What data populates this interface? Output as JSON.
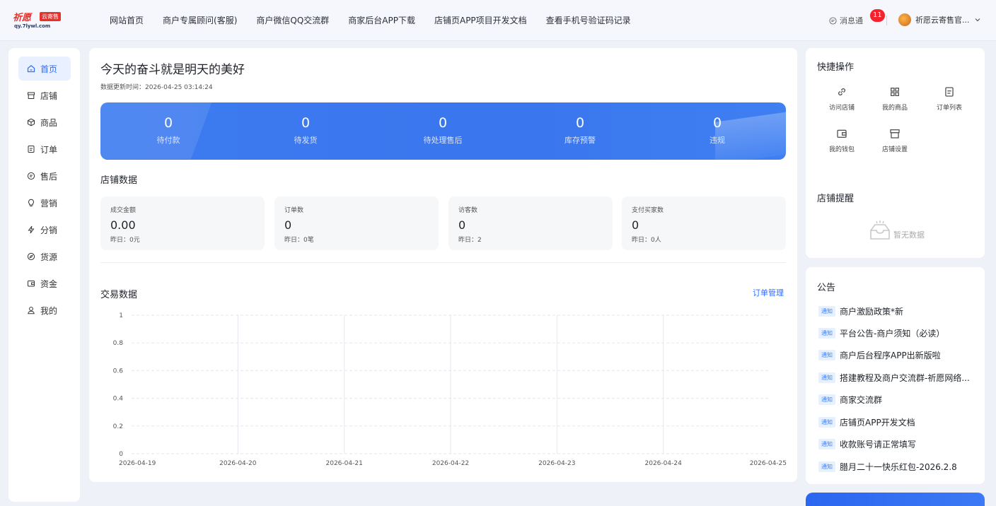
{
  "brand": {
    "logo_text": "祈愿",
    "logo_tag": "云寄售",
    "logo_url": "qy.7lywl.com"
  },
  "topnav": [
    "网站首页",
    "商户专属顾问(客服)",
    "商户微信QQ交流群",
    "商家后台APP下载",
    "店铺页APP项目开发文档",
    "查看手机号验证码记录"
  ],
  "header": {
    "messages_label": "消息通",
    "message_count": "11",
    "user_name": "祈愿云寄售官..."
  },
  "sidebar": {
    "items": [
      {
        "label": "首页",
        "icon": "home-icon",
        "active": true
      },
      {
        "label": "店铺",
        "icon": "store-icon"
      },
      {
        "label": "商品",
        "icon": "box-icon"
      },
      {
        "label": "订单",
        "icon": "order-icon"
      },
      {
        "label": "售后",
        "icon": "aftersale-icon"
      },
      {
        "label": "营销",
        "icon": "bulb-icon"
      },
      {
        "label": "分销",
        "icon": "lightning-icon"
      },
      {
        "label": "货源",
        "icon": "compass-icon"
      },
      {
        "label": "资金",
        "icon": "wallet-icon"
      },
      {
        "label": "我的",
        "icon": "user-icon"
      }
    ]
  },
  "main": {
    "title": "今天的奋斗就是明天的美好",
    "update_time": "数据更新时间：2026-04-25 03:14:24",
    "banner": [
      {
        "value": "0",
        "label": "待付款"
      },
      {
        "value": "0",
        "label": "待发货"
      },
      {
        "value": "0",
        "label": "待处理售后"
      },
      {
        "value": "0",
        "label": "库存预警"
      },
      {
        "value": "0",
        "label": "违规"
      }
    ],
    "store_data_title": "店铺数据",
    "cards": [
      {
        "label": "成交金额",
        "value": "0.00",
        "yesterday": "昨日：0元"
      },
      {
        "label": "订单数",
        "value": "0",
        "yesterday": "昨日：0笔"
      },
      {
        "label": "访客数",
        "value": "0",
        "yesterday": "昨日：2"
      },
      {
        "label": "支付买家数",
        "value": "0",
        "yesterday": "昨日：0人"
      }
    ],
    "trade_title": "交易数据",
    "order_manage": "订单管理"
  },
  "chart_data": {
    "type": "line",
    "categories": [
      "2026-04-19",
      "2026-04-20",
      "2026-04-21",
      "2026-04-22",
      "2026-04-23",
      "2026-04-24",
      "2026-04-25"
    ],
    "values": [
      0,
      0,
      0,
      0,
      0,
      0,
      0
    ],
    "yticks": [
      "0",
      "0.2",
      "0.4",
      "0.6",
      "0.8",
      "1"
    ],
    "ylim": [
      0,
      1
    ],
    "grid": true,
    "line_colors": [
      "#3bd1e8",
      "#6b5cf0"
    ]
  },
  "quick": {
    "title": "快捷操作",
    "items": [
      {
        "label": "访问店铺",
        "icon": "link-icon"
      },
      {
        "label": "我的商品",
        "icon": "grid-icon"
      },
      {
        "label": "订单列表",
        "icon": "list-icon"
      },
      {
        "label": "我的钱包",
        "icon": "wallet-icon"
      },
      {
        "label": "店铺设置",
        "icon": "store-settings-icon"
      }
    ]
  },
  "reminder": {
    "title": "店铺提醒",
    "empty": "暂无数据"
  },
  "notices": {
    "title": "公告",
    "tag": "通知",
    "items": [
      "商户激励政策*新",
      "平台公告-商户须知（必读）",
      "商户后台程序APP出新版啦",
      "搭建教程及商户交流群-祈愿网络...",
      "商家交流群",
      "店铺页APP开发文档",
      "收款账号请正常填写",
      "腊月二十一快乐红包-2026.2.8"
    ]
  },
  "colors": {
    "accent": "#2f6bff",
    "banner": "#3a76ee"
  }
}
